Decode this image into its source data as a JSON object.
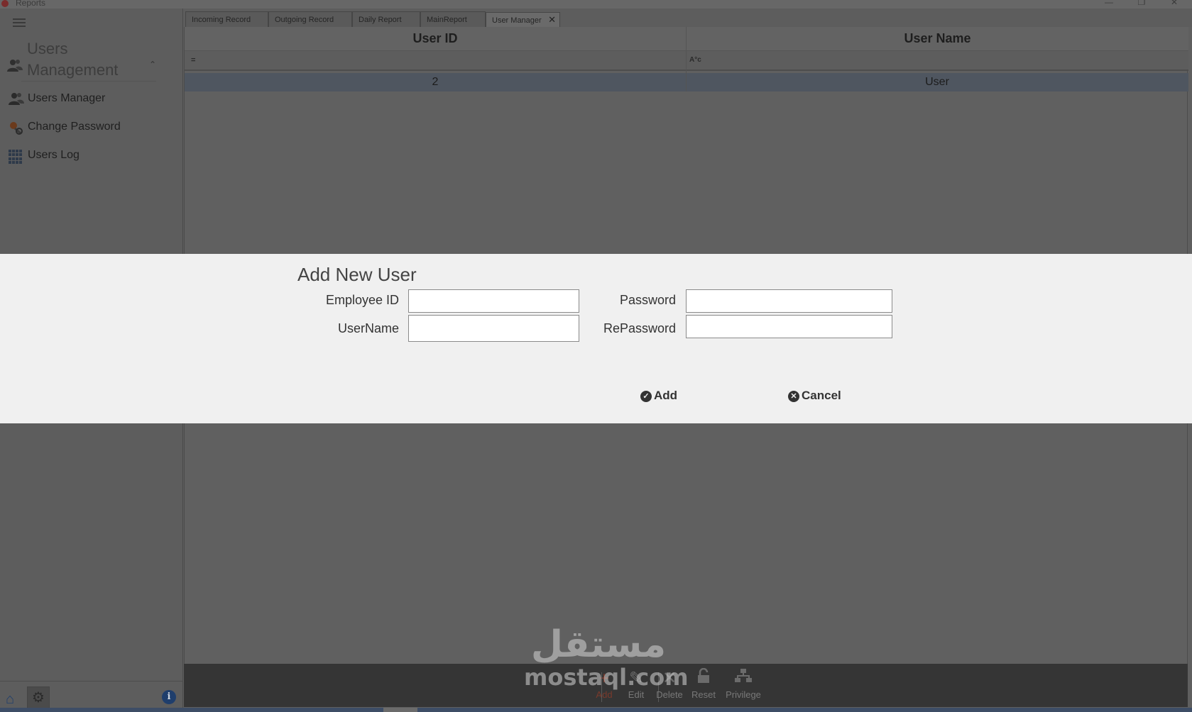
{
  "window": {
    "title": "Reports",
    "minimize": "—",
    "restore": "❐",
    "close": "✕"
  },
  "sidebar": {
    "group_title": "Users Management",
    "group_icon": "users-icon",
    "items": [
      {
        "label": "Users Manager",
        "icon": "users-icon"
      },
      {
        "label": "Change Password",
        "icon": "key-icon"
      },
      {
        "label": "Users Log",
        "icon": "grid-icon"
      }
    ],
    "bottom": {
      "home_icon": "home-icon",
      "settings_icon": "gear-icon",
      "info_icon": "info-icon",
      "info_glyph": "i"
    }
  },
  "tabs": [
    {
      "label": "Incoming Record"
    },
    {
      "label": "Outgoing Record"
    },
    {
      "label": "Daily Report"
    },
    {
      "label": "MainReport"
    },
    {
      "label": "User Manager",
      "active": true
    }
  ],
  "grid": {
    "columns": [
      "User ID",
      "User Name"
    ],
    "filters": [
      "=",
      "A°c"
    ],
    "rows": [
      {
        "user_id": "2",
        "user_name": "User"
      }
    ]
  },
  "toolbar": {
    "actions": [
      {
        "label": "Add",
        "icon": "add-icon"
      },
      {
        "label": "Edit",
        "icon": "edit-icon"
      },
      {
        "label": "Delete",
        "icon": "delete-icon"
      },
      {
        "label": "Reset",
        "icon": "unlock-icon"
      },
      {
        "label": "Privilege",
        "icon": "hierarchy-icon"
      }
    ]
  },
  "watermark": {
    "arabic": "مستقل",
    "latin": "mostaql.com"
  },
  "dialog": {
    "title": "Add New User",
    "fields": {
      "employee_id": {
        "label": "Employee ID",
        "value": ""
      },
      "username": {
        "label": "UserName",
        "value": ""
      },
      "password": {
        "label": "Password",
        "value": ""
      },
      "repassword": {
        "label": "RePassword",
        "value": ""
      }
    },
    "buttons": {
      "add": "Add",
      "cancel": "Cancel"
    }
  }
}
